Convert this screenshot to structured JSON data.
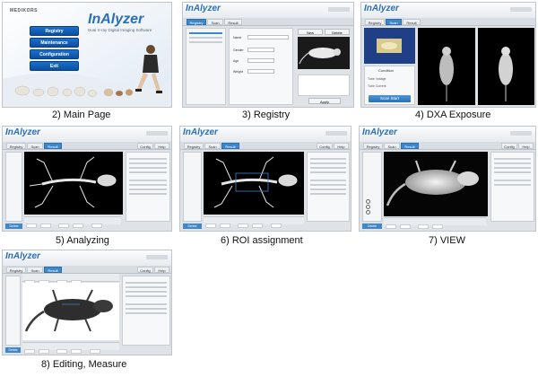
{
  "captions": {
    "p2": "2) Main Page",
    "p3": "3) Registry",
    "p4": "4) DXA Exposure",
    "p5": "5) Analyzing",
    "p6": "6) ROI assignment",
    "p7": "7) VIEW",
    "p8": "8) Editing, Measure"
  },
  "main_page": {
    "vendor": "MEDIKORS",
    "app_title": "InAlyzer",
    "tagline": "Dual X-ray Digital Imaging Software",
    "buttons": [
      "Registry",
      "Maintenance",
      "Configuration",
      "Exit"
    ]
  },
  "app": {
    "brand": "InAlyzer",
    "tabs": [
      "Registry",
      "Scan",
      "Result"
    ],
    "right_tabs": [
      "Config",
      "Help"
    ]
  },
  "registry": {
    "new_button": "New",
    "delete_button": "Delete",
    "apply_button": "Apply",
    "fields": [
      "Name",
      "Gender",
      "Age",
      "Weight"
    ]
  },
  "dxa": {
    "condition_label": "Condition",
    "tube_voltage": "Tube Voltage",
    "tube_current": "Tube Current",
    "scan_button": "Scan Start"
  },
  "footer_button": "Delete",
  "colors": {
    "accent": "#3d87cc",
    "brand": "#2a6fb7",
    "main_button": "#1a6fd0",
    "image_bg": "#000000"
  }
}
